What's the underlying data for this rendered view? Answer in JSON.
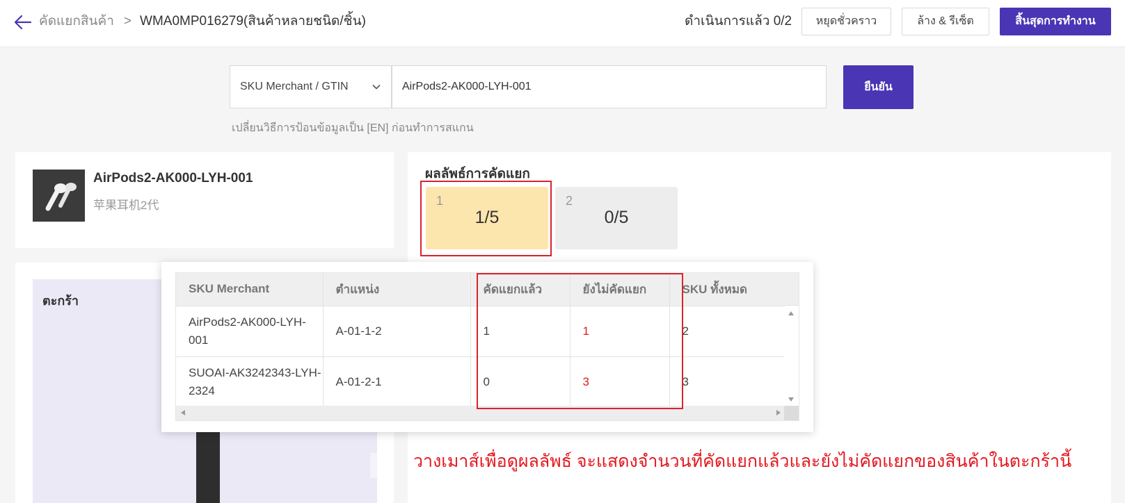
{
  "header": {
    "breadcrumb_parent": "คัดแยกสินค้า",
    "breadcrumb_separator": ">",
    "breadcrumb_current": "WMA0MP016279(สินค้าหลายชนิด/ชิ้น)",
    "progress_text": "ดำเนินการแล้ว 0/2",
    "pause_label": "หยุดชั่วคราว",
    "reset_label": "ล้าง & รีเซ็ต",
    "finish_label": "สิ้นสุดการทำงาน"
  },
  "scan": {
    "select_value": "SKU Merchant / GTIN",
    "input_value": "AirPods2-AK000-LYH-001",
    "confirm_label": "ยืนยัน",
    "hint": "เปลี่ยนวิธีการป้อนข้อมูลเป็น [EN] ก่อนทำการสแกน"
  },
  "product": {
    "name": "AirPods2-AK000-LYH-001",
    "subtitle": "苹果耳机2代",
    "image_icon": "airpods-image"
  },
  "cart": {
    "title": "ตะกร้า"
  },
  "result": {
    "title": "ผลลัพธ์การคัดแยก",
    "boxes": [
      {
        "index": "1",
        "value": "1/5",
        "color": "#fde6ad"
      },
      {
        "index": "2",
        "value": "0/5",
        "color": "#ededed"
      }
    ]
  },
  "table": {
    "headers": [
      "SKU Merchant",
      "ตำแหน่ง",
      "คัดแยกแล้ว",
      "ยังไม่คัดแยก",
      "SKU ทั้งหมด"
    ],
    "rows": [
      {
        "sku": "AirPods2-AK000-LYH-001",
        "location": "A-01-1-2",
        "sorted": "1",
        "unsorted": "1",
        "total": "2"
      },
      {
        "sku": "SUOAI-AK3242343-LYH-2324",
        "location": "A-01-2-1",
        "sorted": "0",
        "unsorted": "3",
        "total": "3"
      }
    ]
  },
  "annotation": "วางเมาส์เพื่อดูผลลัพธ์ จะแสดงจำนวนที่คัดแยกแล้วและยังไม่คัดแยกของสินค้าในตะกร้านี้",
  "colors": {
    "primary": "#4a35b5",
    "highlight_red": "#d9232d",
    "unsorted_red": "#e3171f",
    "active_box": "#fde6ad"
  }
}
